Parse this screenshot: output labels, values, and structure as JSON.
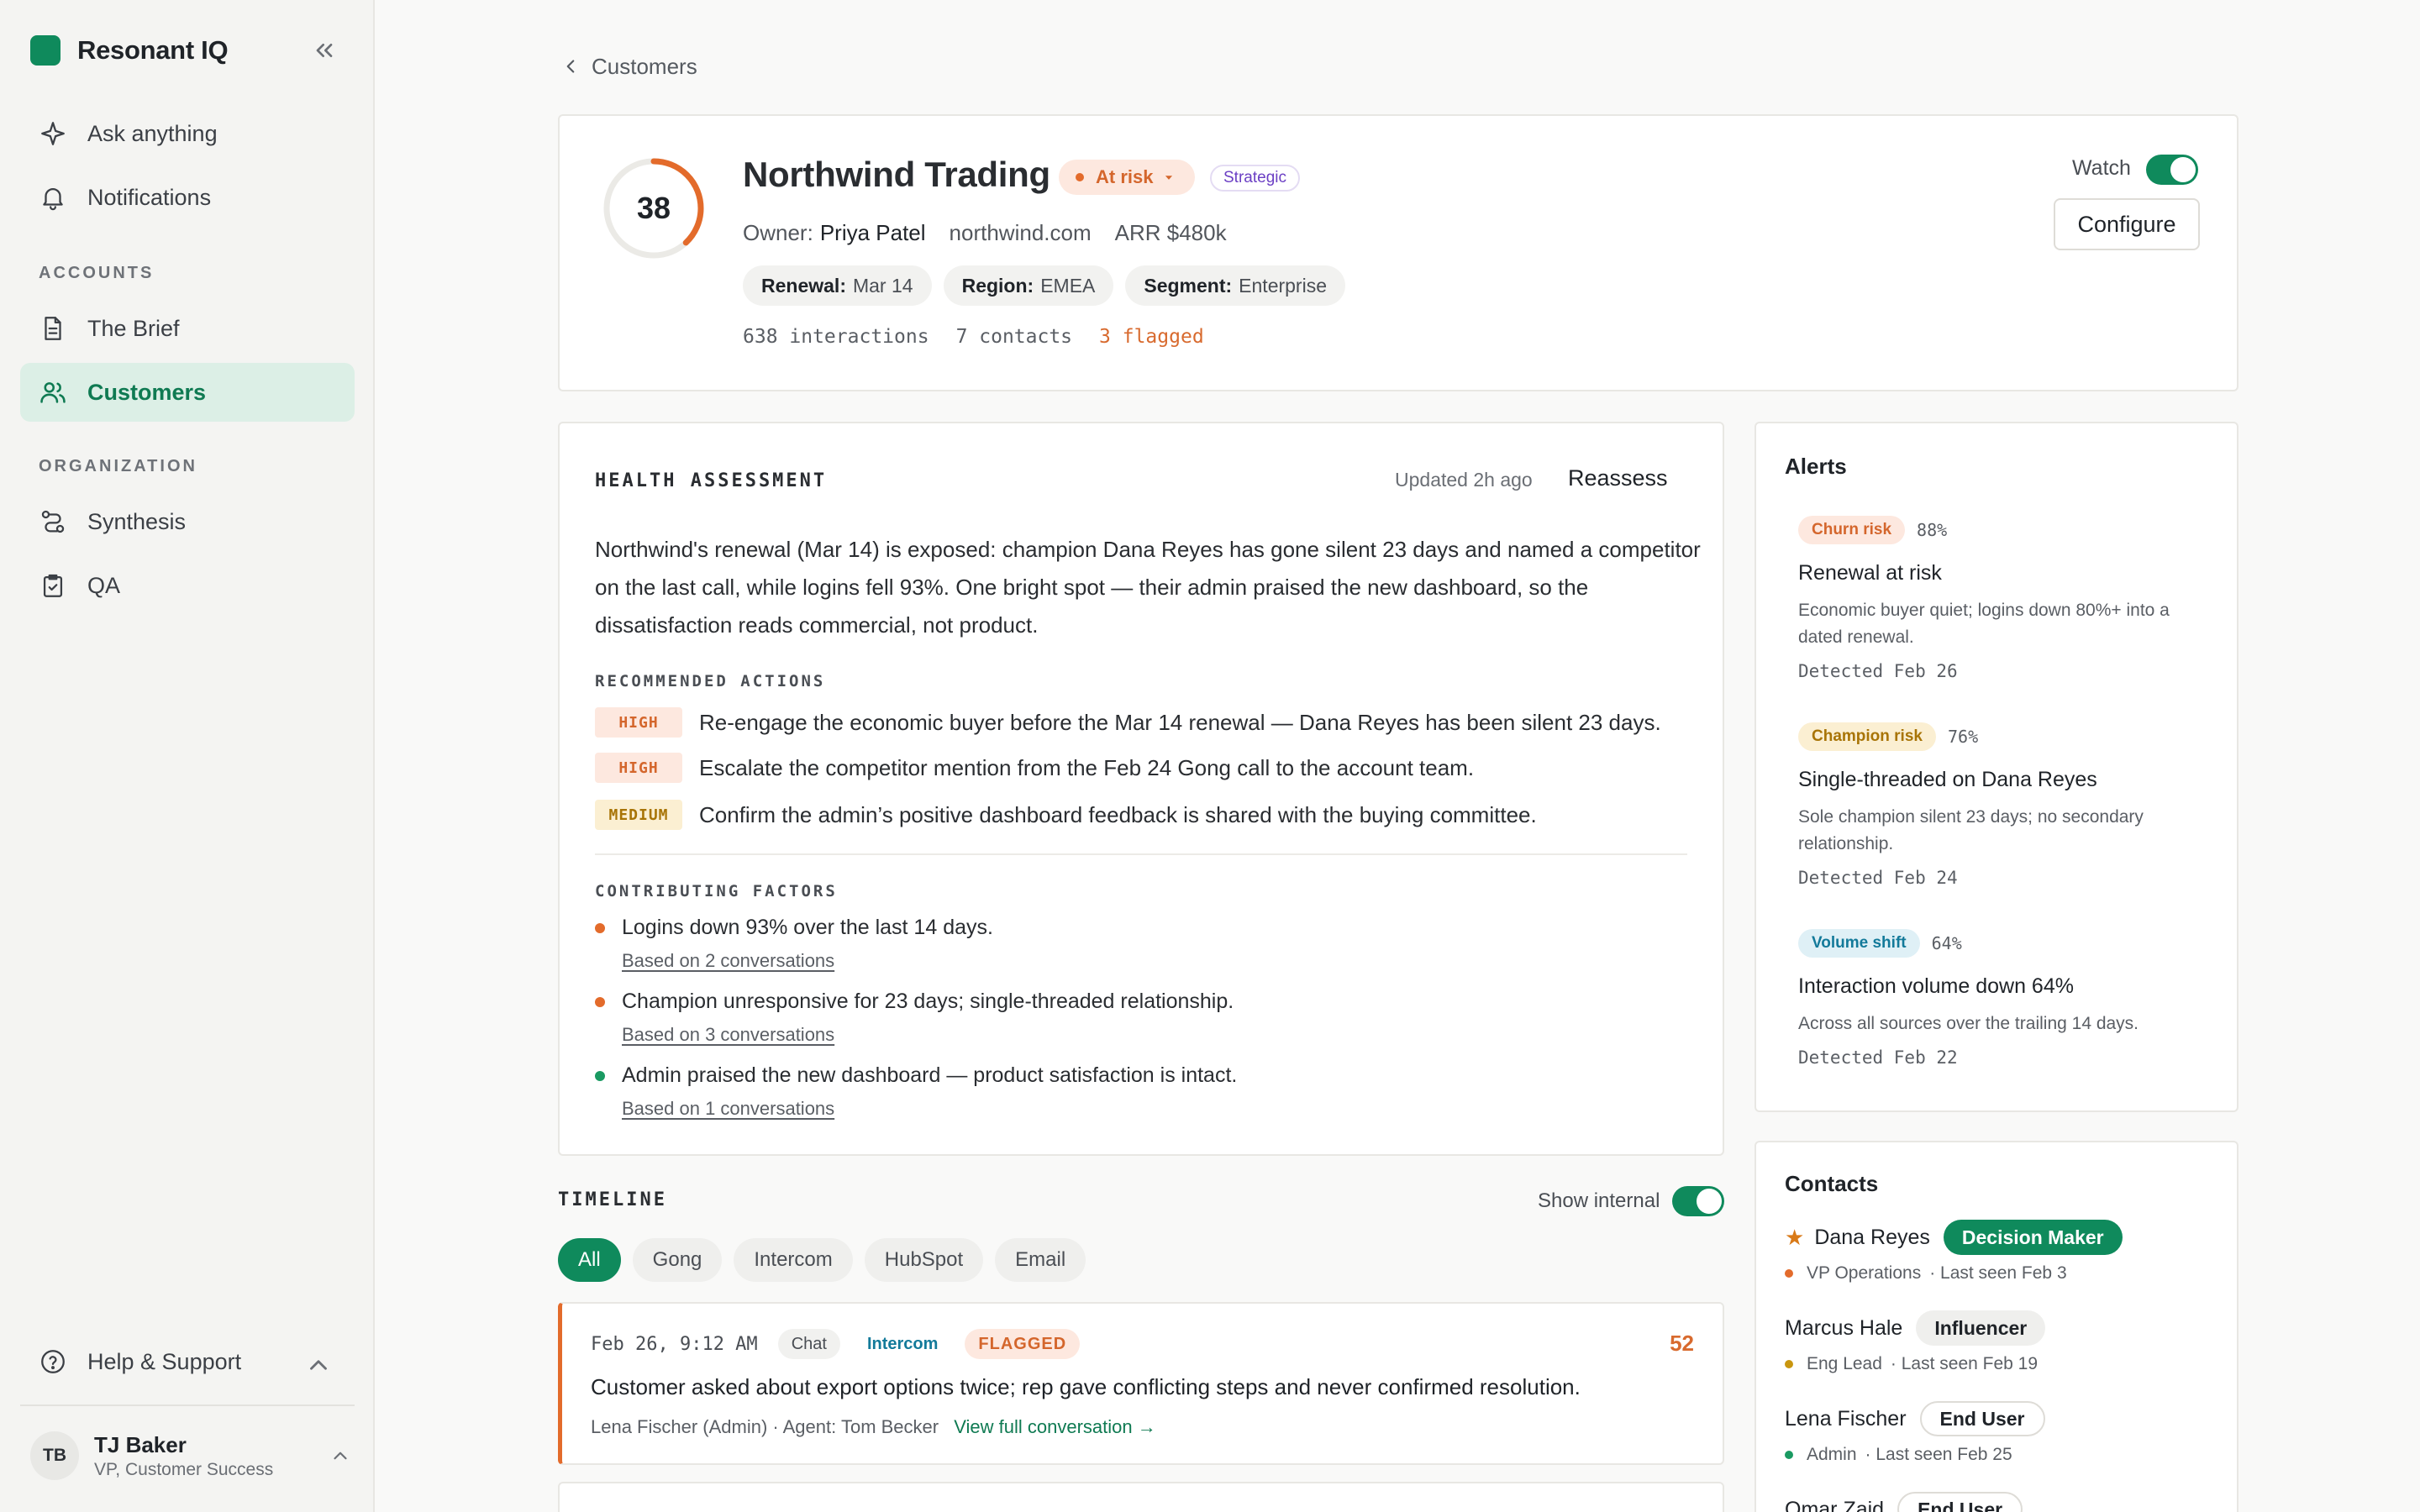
{
  "app": {
    "brand": "Resonant IQ"
  },
  "sidebar": {
    "top_items": [
      {
        "label": "Ask anything",
        "icon": "sparkle-icon"
      },
      {
        "label": "Notifications",
        "icon": "bell-icon"
      }
    ],
    "sections": [
      {
        "title": "ACCOUNTS",
        "items": [
          {
            "label": "The Brief",
            "icon": "document-icon"
          },
          {
            "label": "Customers",
            "icon": "users-icon",
            "active": true
          }
        ]
      },
      {
        "title": "ORGANIZATION",
        "items": [
          {
            "label": "Synthesis",
            "icon": "route-icon"
          },
          {
            "label": "QA",
            "icon": "clipboard-check-icon"
          }
        ]
      }
    ],
    "help": {
      "label": "Help & Support"
    },
    "user": {
      "initials": "TB",
      "name": "TJ Baker",
      "role": "VP, Customer Success"
    }
  },
  "breadcrumb": {
    "label": "Customers"
  },
  "account": {
    "score": 38,
    "score_max": 100,
    "name": "Northwind Trading",
    "status": "At risk",
    "tier": "Strategic",
    "owner_label": "Owner:",
    "owner": "Priya Patel",
    "domain": "northwind.com",
    "arr": "ARR $480k",
    "chips": [
      {
        "key": "Renewal:",
        "value": "Mar 14"
      },
      {
        "key": "Region:",
        "value": "EMEA"
      },
      {
        "key": "Segment:",
        "value": "Enterprise"
      }
    ],
    "stats": {
      "interactions": "638 interactions",
      "contacts": "7 contacts",
      "flagged": "3 flagged"
    },
    "watch_label": "Watch",
    "watch_on": true,
    "configure_label": "Configure"
  },
  "health": {
    "title": "HEALTH ASSESSMENT",
    "updated": "Updated 2h ago",
    "reassess_label": "Reassess",
    "summary": "Northwind's renewal (Mar 14) is exposed: champion Dana Reyes has gone silent 23 days and named a competitor on the last call, while logins fell 93%. One bright spot — their admin praised the new dashboard, so the dissatisfaction reads commercial, not product.",
    "actions_title": "RECOMMENDED ACTIONS",
    "actions": [
      {
        "priority": "HIGH",
        "level": "high",
        "text": "Re-engage the economic buyer before the Mar 14 renewal — Dana Reyes has been silent 23 days."
      },
      {
        "priority": "HIGH",
        "level": "high",
        "text": "Escalate the competitor mention from the Feb 24 Gong call to the account team."
      },
      {
        "priority": "MEDIUM",
        "level": "medium",
        "text": "Confirm the admin’s positive dashboard feedback is shared with the buying committee."
      }
    ],
    "factors_title": "CONTRIBUTING FACTORS",
    "factors": [
      {
        "text": "Logins down 93% over the last 14 days.",
        "link": "Based on 2 conversations",
        "color": "#e36b2b"
      },
      {
        "text": "Champion unresponsive for 23 days; single-threaded relationship.",
        "link": "Based on 3 conversations",
        "color": "#e36b2b"
      },
      {
        "text": "Admin praised the new dashboard — product satisfaction is intact.",
        "link": "Based on 1 conversations",
        "color": "#1a9a62"
      }
    ]
  },
  "timeline": {
    "title": "TIMELINE",
    "show_internal_label": "Show internal",
    "show_internal_on": true,
    "tabs": [
      "All",
      "Gong",
      "Intercom",
      "HubSpot",
      "Email"
    ],
    "events": [
      {
        "time": "Feb 26, 9:12 AM",
        "type": "Chat",
        "source": "Intercom",
        "flag": "FLAGGED",
        "score": "52",
        "text": "Customer asked about export options twice; rep gave conflicting steps and never confirmed resolution.",
        "meta": "Lena Fischer (Admin) · Agent: Tom Becker",
        "link": "View full conversation →"
      }
    ]
  },
  "alerts": {
    "title": "Alerts",
    "items": [
      {
        "tag": "Churn risk",
        "tag_bg": "#fde8df",
        "tag_fg": "#d4662c",
        "pct": "88%",
        "title": "Renewal at risk",
        "desc": "Economic buyer quiet; logins down 80%+ into a dated renewal.",
        "detected": "Detected Feb 26"
      },
      {
        "tag": "Champion risk",
        "tag_bg": "#fbefd2",
        "tag_fg": "#a87406",
        "pct": "76%",
        "title": "Single-threaded on Dana Reyes",
        "desc": "Sole champion silent 23 days; no secondary relationship.",
        "detected": "Detected Feb 24"
      },
      {
        "tag": "Volume shift",
        "tag_bg": "#dff0f6",
        "tag_fg": "#137a9a",
        "pct": "64%",
        "title": "Interaction volume down 64%",
        "desc": "Across all sources over the trailing 14 days.",
        "detected": "Detected Feb 22"
      }
    ]
  },
  "contacts": {
    "title": "Contacts",
    "items": [
      {
        "name": "Dana Reyes",
        "star": "★",
        "role": "Decision Maker",
        "role_kind": "dm",
        "title": "VP Operations",
        "seen": "· Last seen Feb 3",
        "dot": "#e36b2b"
      },
      {
        "name": "Marcus Hale",
        "role": "Influencer",
        "role_kind": "inf",
        "title": "Eng Lead",
        "seen": "· Last seen Feb 19",
        "dot": "#c9960f"
      },
      {
        "name": "Lena Fischer",
        "role": "End User",
        "role_kind": "eu",
        "title": "Admin",
        "seen": "· Last seen Feb 25",
        "dot": "#1a9a62"
      },
      {
        "name": "Omar Zaid",
        "role": "End User",
        "role_kind": "eu"
      }
    ]
  }
}
